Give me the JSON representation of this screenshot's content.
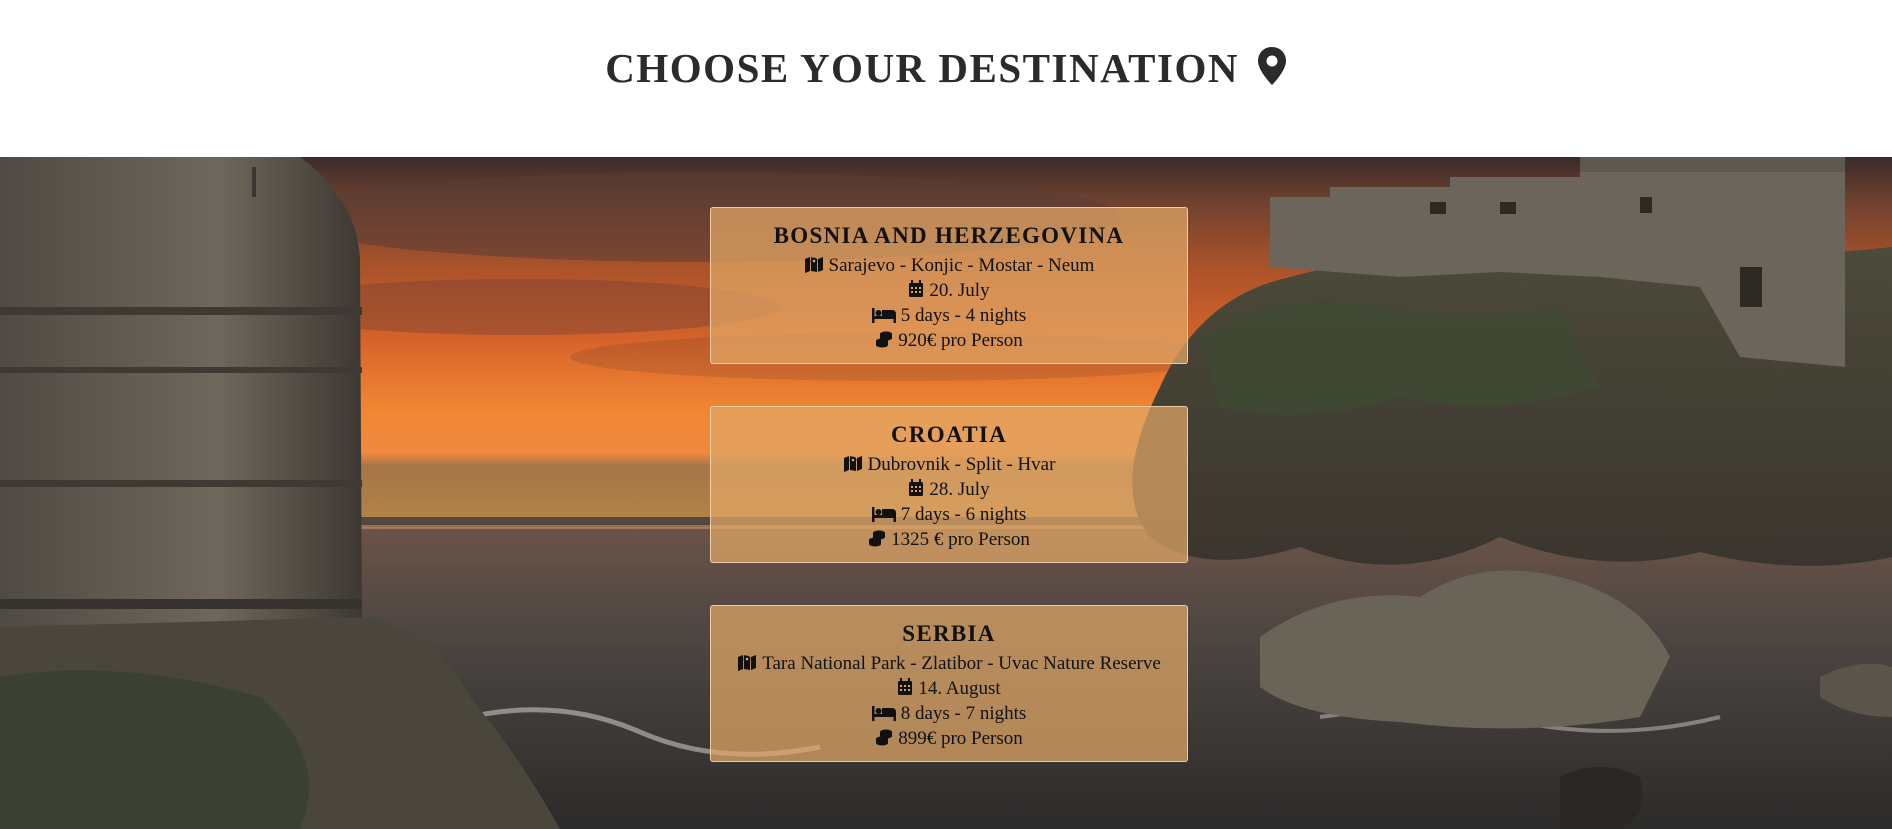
{
  "header": {
    "title": "CHOOSE YOUR DESTINATION",
    "title_icon": "map-marker-icon"
  },
  "hero": {
    "background": "sunset coast with stone fortress and rocky cliffs"
  },
  "destinations": [
    {
      "name": "BOSNIA AND HERZEGOVINA",
      "route": "Sarajevo - Konjic - Mostar - Neum",
      "date": "20. July",
      "duration": "5 days - 4 nights",
      "price": "920€ pro Person"
    },
    {
      "name": "CROATIA",
      "route": "Dubrovnik - Split - Hvar",
      "date": "28. July",
      "duration": "7 days - 6 nights",
      "price": "1325 € pro Person"
    },
    {
      "name": "SERBIA",
      "route": "Tara National Park - Zlatibor - Uvac Nature Reserve",
      "date": "14. August",
      "duration": "8 days - 7 nights",
      "price": "899€ pro Person"
    }
  ],
  "icons": {
    "route": "map-location-icon",
    "date": "calendar-icon",
    "duration": "bed-icon",
    "price": "coins-icon"
  },
  "colors": {
    "title": "#2b2b2b",
    "card_background": "#e2a867",
    "card_text": "#111111"
  }
}
